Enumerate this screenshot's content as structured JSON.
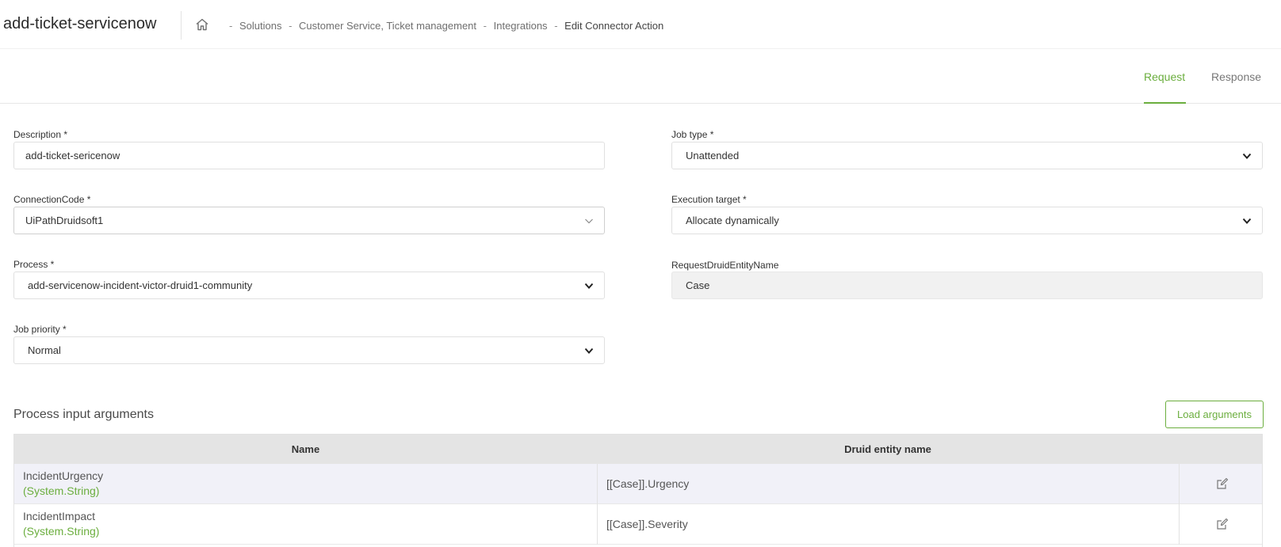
{
  "app": {
    "title": "add-ticket-servicenow"
  },
  "breadcrumb": {
    "home_icon": "home-icon",
    "separator": "-",
    "items": [
      "Solutions",
      "Customer Service, Ticket management",
      "Integrations"
    ],
    "current": "Edit Connector Action"
  },
  "tabs": [
    {
      "label": "Request",
      "active": true
    },
    {
      "label": "Response",
      "active": false
    }
  ],
  "form": {
    "description": {
      "label": "Description *",
      "value": "add-ticket-sericenow"
    },
    "connection_code": {
      "label": "ConnectionCode *",
      "value": "UiPathDruidsoft1"
    },
    "process": {
      "label": "Process *",
      "value": "add-servicenow-incident-victor-druid1-community"
    },
    "job_priority": {
      "label": "Job priority *",
      "value": "Normal"
    },
    "job_type": {
      "label": "Job type *",
      "value": "Unattended"
    },
    "execution_target": {
      "label": "Execution target *",
      "value": "Allocate dynamically"
    },
    "request_entity": {
      "label": "RequestDruidEntityName",
      "value": "Case"
    }
  },
  "arguments": {
    "title": "Process input arguments",
    "load_button": "Load arguments",
    "columns": [
      "Name",
      "Druid entity name"
    ],
    "rows": [
      {
        "name": "IncidentUrgency",
        "type": "(System.String)",
        "entity": "[[Case]].Urgency"
      },
      {
        "name": "IncidentImpact",
        "type": "(System.String)",
        "entity": "[[Case]].Severity"
      }
    ]
  },
  "colors": {
    "accent": "#6bae3e",
    "header_row": "#e4e4e4",
    "readonly_bg": "#f1f1f1"
  }
}
